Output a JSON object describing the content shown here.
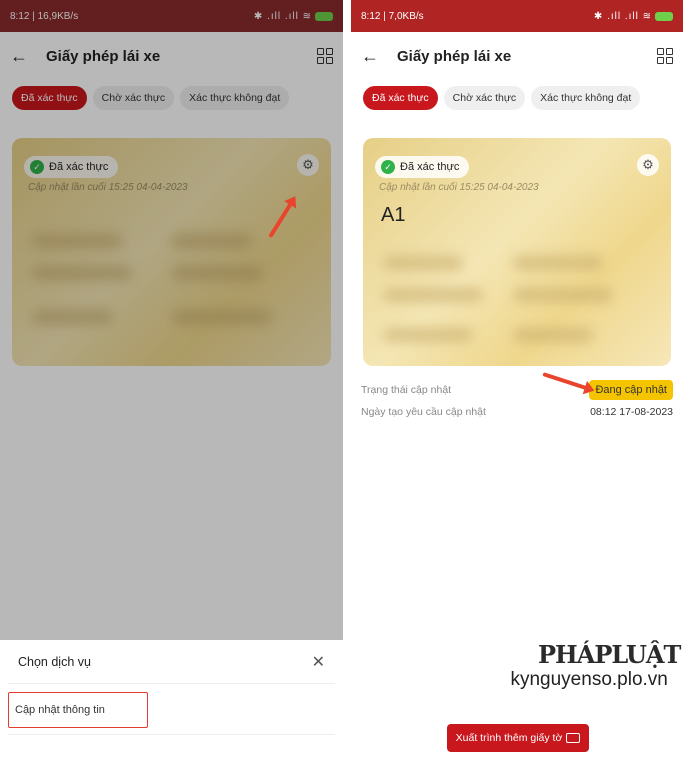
{
  "statusbar": {
    "left": {
      "time_speed": "8:12 | 16,9KB/s",
      "icons": "✈ ⏰ ♥"
    },
    "right": {
      "time_speed": "8:12 | 7,0KB/s",
      "icons": "✈ ⏰ ♥"
    },
    "signal": "✱ .ıll .ıll ≋"
  },
  "appbar": {
    "title": "Giấy phép lái xe",
    "back_icon": "←"
  },
  "tabs": [
    {
      "label": "Đã xác thực",
      "active": true
    },
    {
      "label": "Chờ xác thực",
      "active": false
    },
    {
      "label": "Xác thực không đạt",
      "active": false
    }
  ],
  "card": {
    "status_label": "Đã xác thực",
    "last_updated": "Cập nhật lần cuối 15:25 04-04-2023",
    "license_class": "A1"
  },
  "sheet": {
    "title": "Chọn dịch vụ",
    "close_icon": "✕",
    "item": "Cập nhật thông tin"
  },
  "details": {
    "update_status_label": "Trạng thái cập nhật",
    "update_status_value": "Đang cập nhật",
    "request_date_label": "Ngày tạo yêu cầu cập nhật",
    "request_date_value": "08:12 17-08-2023"
  },
  "watermark": {
    "logo": "PHÁPLUẬT",
    "site": "kynguyenso.plo.vn"
  },
  "bottom_button": {
    "label": "Xuất trình thêm giấy tờ"
  },
  "colors": {
    "brand": "#c8171d",
    "status_yellow": "#f5c400",
    "arrow": "#e8452c"
  }
}
